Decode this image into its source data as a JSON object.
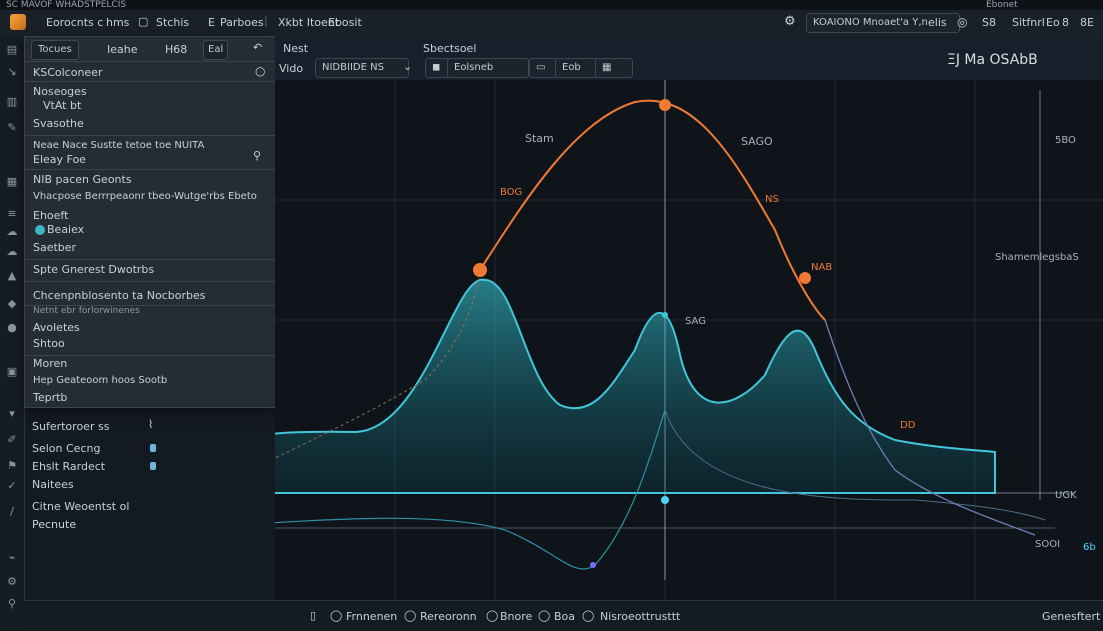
{
  "titlebar": {
    "text": "SC  MAVOF WHADSTPELCIS"
  },
  "menubar": {
    "items": [
      "Eorocnts c",
      "hms",
      "Stchis",
      "E",
      "Parboes",
      "Xkbt Itoent",
      "Ebosit"
    ],
    "search_value": "KOAIONO Mnoaet'a Y,n",
    "search_tag": "elis",
    "right_labels": [
      "S8",
      "Ebonet",
      "Sitfnrl",
      "Eo",
      "8",
      "8E"
    ]
  },
  "panel": {
    "header_tabs": [
      "Tocues",
      "Ieahe",
      "H68"
    ],
    "header_badge": "Eal",
    "row1": "KSColconeer",
    "sec1": [
      "Noseoges",
      "VtAt bt",
      "Svasothe"
    ],
    "sec2_title": "Neae Nace Sustte tetoe toe NUITA",
    "sec2_sub": "Eleay   Foe",
    "sec3_title": "NIB pacen Geonts",
    "sec3_desc": "Vhacpose Berrrpeaonr tbeo-Wutge'rbs Ebeto",
    "sec3_items": [
      "Ehoeft",
      "Beaiex",
      "Saetber"
    ],
    "sec4": "Spte Gnerest Dwotrbs",
    "sec5": "Chcenpnblosento ta Nocborbes",
    "sec5_sub": "Netnt ebr forlorwinenes",
    "sec6": [
      "Avoletes",
      "Shtoo"
    ],
    "sec7": [
      "Moren",
      "Hep Geateoom hoos Sootb",
      "Teprtb"
    ]
  },
  "controls": {
    "items": [
      "Sufertoroer ss",
      "Selon Cecng",
      "Ehslt Rardect",
      "Naitees",
      "Citne Weoentst ol",
      "Pecnute"
    ]
  },
  "plot_toolbar": {
    "left_buttons": [
      "Nest",
      "Vido"
    ],
    "title": "Sbectsoel",
    "search_value": "NIDBIIDE   NS",
    "tool_labels": [
      "Eolsneb",
      "Eob"
    ],
    "right_title": "ΞJ  Ma  OSAbB"
  },
  "plot": {
    "labels": [
      "Stam",
      "SAGO",
      "BOG",
      "NS",
      "5BO",
      "SAG",
      "NAB",
      "DD",
      "UGK",
      "ShamemlegsbaS",
      "SOOI",
      "6b"
    ],
    "peak_line_color": "#f07a34",
    "curve_color": "#42c6d9"
  },
  "statusbar": {
    "items": [
      "Frnnenen",
      "Rereoronn",
      "Bnore",
      "Boa",
      "Nisroeottrusttt"
    ],
    "right": "Genesftert"
  }
}
